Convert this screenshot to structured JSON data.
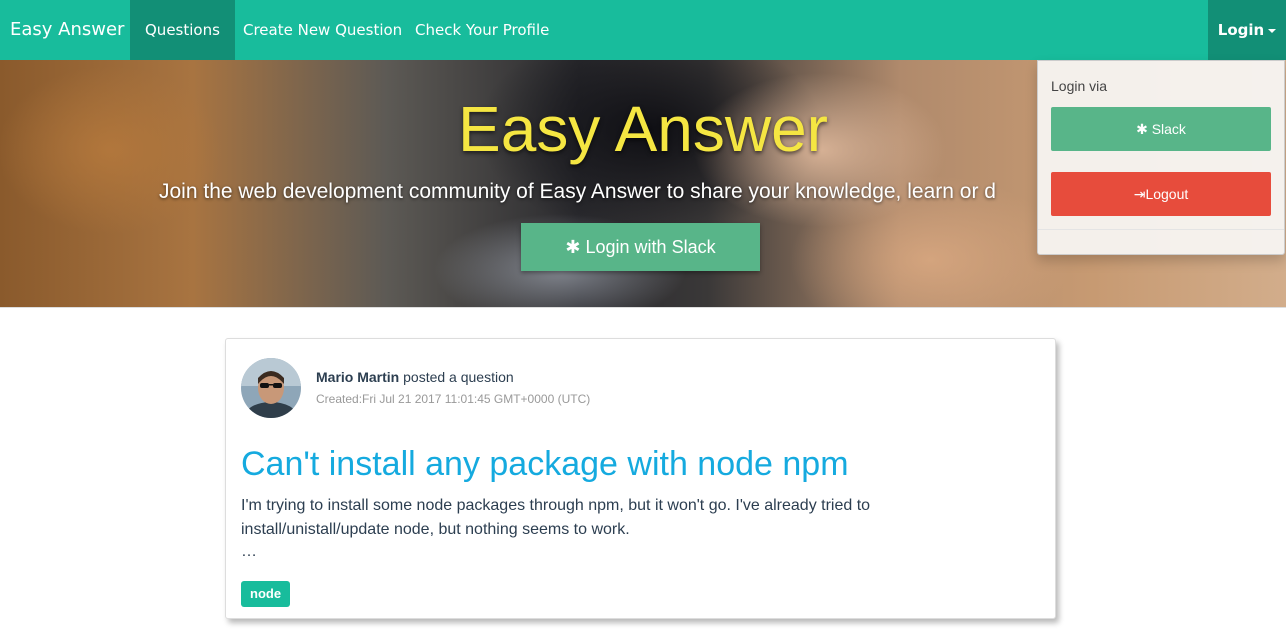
{
  "navbar": {
    "brand": "Easy Answer",
    "items": [
      {
        "label": "Questions",
        "active": true
      },
      {
        "label": "Create New Question",
        "active": false
      },
      {
        "label": "Check Your Profile",
        "active": false
      }
    ],
    "login_label": "Login",
    "color": "#18bc9c"
  },
  "hero": {
    "title": "Easy Answer",
    "subtitle": "Join the web development community of Easy Answer to share your knowledge, learn or d",
    "button_label": "Login with Slack",
    "button_icon": "gear-icon"
  },
  "dropdown": {
    "label": "Login via",
    "slack_label": "Slack",
    "slack_icon": "gear-icon",
    "logout_label": "Logout",
    "logout_icon": "sign-out-icon"
  },
  "question": {
    "author": "Mario Martin",
    "action": " posted a question",
    "created": "Created:Fri Jul 21 2017 11:01:45 GMT+0000 (UTC)",
    "title": "Can't install any package with node npm",
    "body": "I'm trying to install some node packages through npm, but it won't go. I've already tried to install/unistall/update node, but nothing seems to work.",
    "more": "…",
    "tags": [
      "node"
    ]
  }
}
